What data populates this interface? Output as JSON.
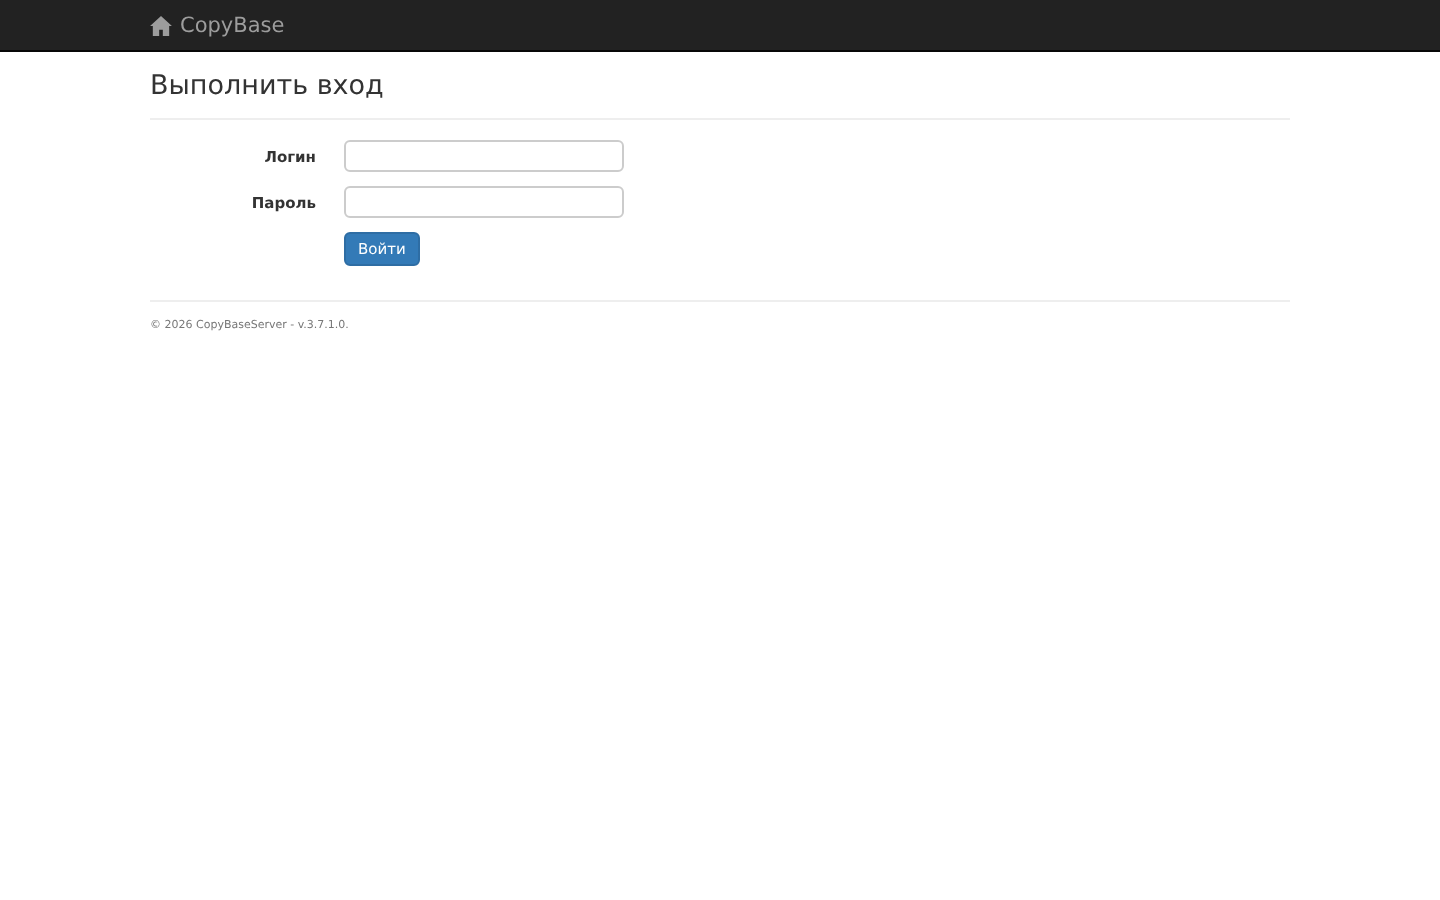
{
  "navbar": {
    "brand": "CopyBase"
  },
  "page": {
    "title": "Выполнить вход"
  },
  "form": {
    "fields": [
      {
        "label": "Логин"
      },
      {
        "label": "Пароль"
      }
    ],
    "submit": "Войти"
  },
  "footer": "© 2026 CopyBaseServer - v.3.7.1.0."
}
